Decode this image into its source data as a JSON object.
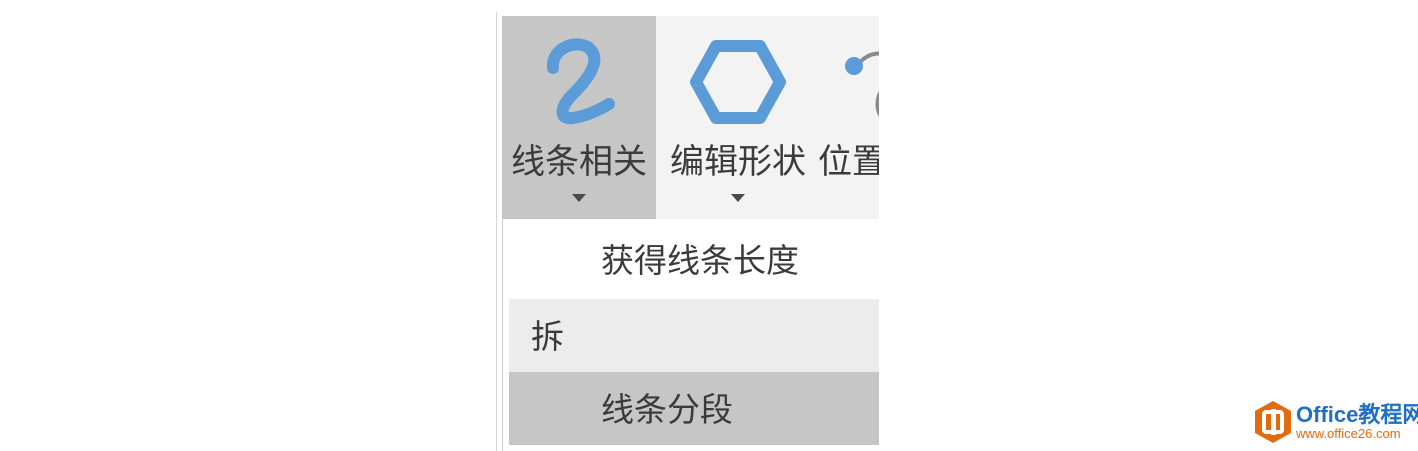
{
  "ribbon": {
    "buttons": [
      {
        "label": "线条相关",
        "icon": "curve-line-icon",
        "active": true
      },
      {
        "label": "编辑形状",
        "icon": "hexagon-icon",
        "active": false
      },
      {
        "label": "位置",
        "icon": "position-curve-icon",
        "active": false
      }
    ]
  },
  "menu": {
    "items": [
      {
        "label": "获得线条长度"
      },
      {
        "label": "拆"
      },
      {
        "label": "线条分段"
      }
    ]
  },
  "watermark": {
    "brand": "Office教程网",
    "url": "www.office26.com"
  },
  "colors": {
    "icon_blue": "#5a9bd8",
    "ribbon_bg": "#f3f3f3",
    "active_bg": "#c6c6c6",
    "header_bg": "#ececec",
    "logo_orange": "#e36a0e",
    "logo_blue": "#1f6fc4"
  }
}
